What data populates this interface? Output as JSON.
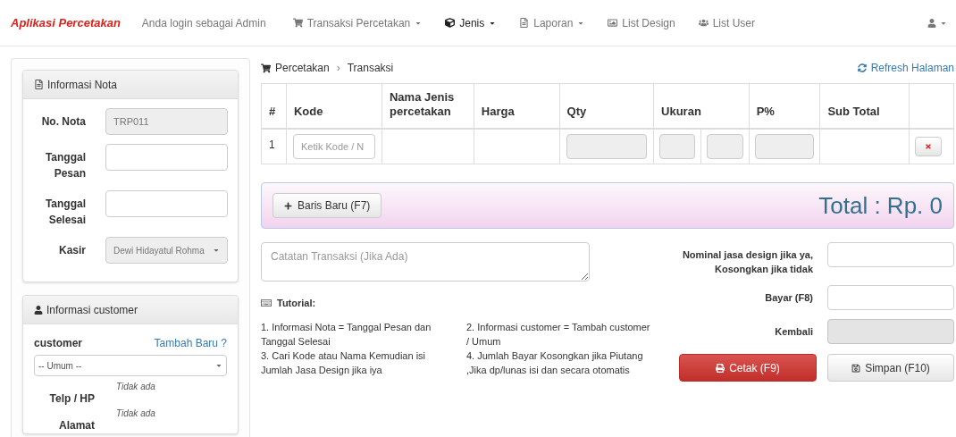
{
  "navbar": {
    "brand": "Aplikasi Percetakan",
    "login_text": "Anda login sebagai Admin",
    "items": [
      {
        "label": "Transaksi Percetakan",
        "dropdown": true,
        "selected": false
      },
      {
        "label": "Jenis",
        "dropdown": true,
        "selected": true
      },
      {
        "label": "Laporan",
        "dropdown": true,
        "selected": false
      },
      {
        "label": "List Design",
        "dropdown": false,
        "selected": false
      },
      {
        "label": "List User",
        "dropdown": false,
        "selected": false
      }
    ]
  },
  "nota_panel": {
    "title": "Informasi Nota",
    "fields": [
      {
        "label": "No. Nota",
        "kind": "input",
        "value": "TRP011",
        "disabled": true
      },
      {
        "label": "Tanggal Pesan",
        "kind": "input",
        "disabled": false
      },
      {
        "label": "Tanggal Selesai",
        "kind": "input",
        "disabled": false
      },
      {
        "label": "Kasir",
        "kind": "select",
        "value": "Dewi Hidayatul Rohma",
        "disabled": true
      }
    ]
  },
  "customer_panel": {
    "title": "Informasi customer",
    "customer_label": "customer",
    "add_link": "Tambah Baru ?",
    "customer_value": "-- Umum --",
    "details": [
      {
        "label": "Telp / HP",
        "value": "Tidak ada"
      },
      {
        "label": "Alamat",
        "value": "Tidak ada"
      }
    ]
  },
  "breadcrumb": [
    "Percetakan",
    "Transaksi"
  ],
  "breadcrumb_separator": "›",
  "refresh_link": "Refresh Halaman",
  "table": {
    "columns": [
      "#",
      "Kode",
      "Nama Jenis percetakan",
      "Harga",
      "Qty",
      "Ukuran",
      "P%",
      "Sub Total"
    ],
    "rows": [
      {
        "number": "1",
        "kode_placeholder": "Ketik Kode / N"
      }
    ]
  },
  "add_row_button": "Baris Baru (F7)",
  "total": "Total : Rp. 0",
  "notes_placeholder": "Catatan Transaksi (Jika Ada)",
  "tutorial": {
    "title": "Tutorial:",
    "items": [
      "1. Informasi Nota = Tanggal Pesan dan Tanggal Selesai",
      "2. Informasi customer = Tambah customer / Umum",
      "3. Cari Kode atau Nama Kemudian isi Jumlah Jasa Design jika iya",
      "4. Jumlah Bayar Kosongkan jika Piutang ,Jika dp/lunas isi dan secara otomatis"
    ]
  },
  "payment_fields": [
    {
      "label": "Nominal jasa design jika ya, Kosongkan jika tidak",
      "disabled": false
    },
    {
      "label": "Bayar (F8)",
      "disabled": false
    },
    {
      "label": "Kembali",
      "disabled": true
    }
  ],
  "print_button": "Cetak (F9)",
  "save_button": "Simpan (F10)"
}
